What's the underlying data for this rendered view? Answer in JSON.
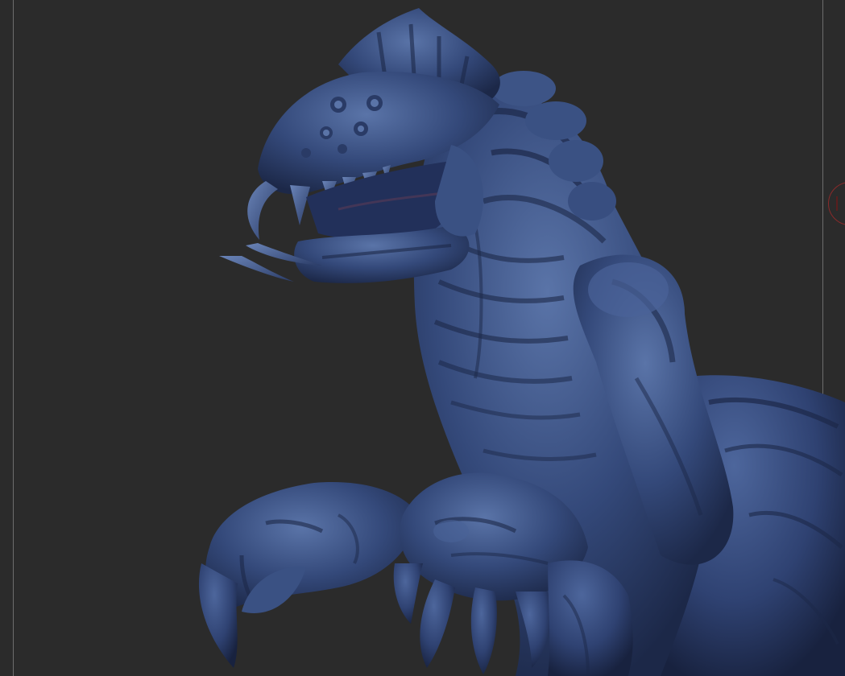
{
  "viewport": {
    "background_color": "#2b2b2b",
    "frame_line_color": "#6d6d6d",
    "gizmo_color": "#8a2a2a"
  },
  "sculpt": {
    "subject": "creature-sculpt",
    "material_color": "#34497a",
    "shadow_color": "#1c2848",
    "highlight_color": "#5a74a8",
    "cavity_color": "#5a3a55"
  }
}
